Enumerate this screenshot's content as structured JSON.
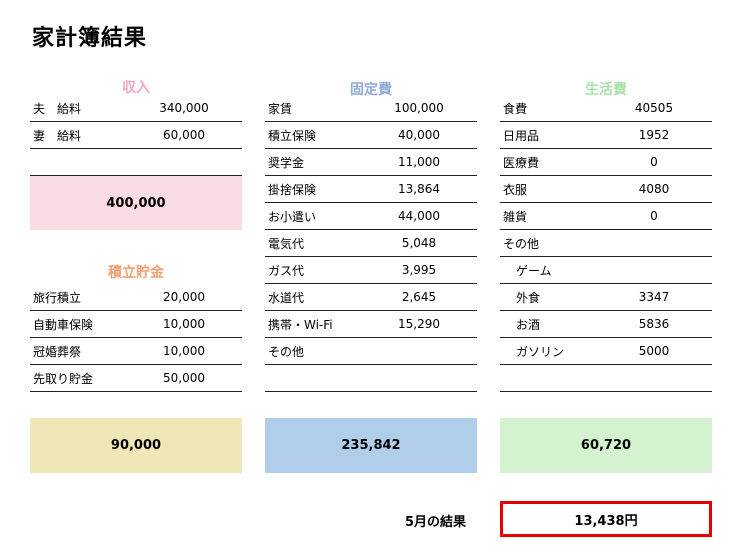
{
  "title": "家計簿結果",
  "colors": {
    "income_head": "#f4a6c4",
    "fixed_head": "#8fa8dc",
    "living_head": "#a9e2a9",
    "savings_head": "#f2a06f",
    "income_box": "#f9dbe2",
    "savings_box": "#efe7b8",
    "fixed_box": "#b0cde9",
    "living_box": "#d5f2d0",
    "result_border": "#e60000"
  },
  "income": {
    "heading": "収入",
    "rows": [
      {
        "label": "夫　給料",
        "value": "340,000"
      },
      {
        "label": "妻　給料",
        "value": "60,000"
      }
    ],
    "total": "400,000"
  },
  "savings": {
    "heading": "積立貯金",
    "rows": [
      {
        "label": "旅行積立",
        "value": "20,000"
      },
      {
        "label": "自動車保険",
        "value": "10,000"
      },
      {
        "label": "冠婚葬祭",
        "value": "10,000"
      },
      {
        "label": "先取り貯金",
        "value": "50,000"
      }
    ],
    "total": "90,000"
  },
  "fixed": {
    "heading": "固定費",
    "rows": [
      {
        "label": "家賃",
        "value": "100,000"
      },
      {
        "label": "積立保険",
        "value": "40,000"
      },
      {
        "label": "奨学金",
        "value": "11,000"
      },
      {
        "label": "掛捨保険",
        "value": "13,864"
      },
      {
        "label": "お小遣い",
        "value": "44,000"
      },
      {
        "label": "電気代",
        "value": "5,048"
      },
      {
        "label": "ガス代",
        "value": "3,995"
      },
      {
        "label": "水道代",
        "value": "2,645"
      },
      {
        "label": "携帯・Wi-Fi",
        "value": "15,290"
      },
      {
        "label": "その他",
        "value": ""
      },
      {
        "label": "",
        "value": ""
      }
    ],
    "total": "235,842"
  },
  "living": {
    "heading": "生活費",
    "rows": [
      {
        "label": "食費",
        "value": "40505"
      },
      {
        "label": "日用品",
        "value": "1952"
      },
      {
        "label": "医療費",
        "value": "0"
      },
      {
        "label": "衣服",
        "value": "4080"
      },
      {
        "label": "雑貨",
        "value": "0"
      },
      {
        "label": "その他",
        "value": ""
      },
      {
        "label": "ゲーム",
        "value": ""
      },
      {
        "label": "外食",
        "value": "3347"
      },
      {
        "label": "お酒",
        "value": "5836"
      },
      {
        "label": "ガソリン",
        "value": "5000"
      },
      {
        "label": "",
        "value": ""
      }
    ],
    "total": "60,720"
  },
  "result": {
    "label": "5月の結果",
    "value": "13,438円"
  }
}
